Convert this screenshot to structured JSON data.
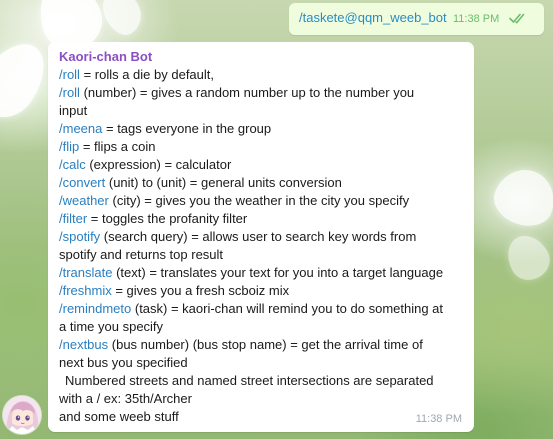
{
  "outgoing": {
    "text": "/taskete@qqm_weeb_bot",
    "time": "11:38 PM",
    "status_icon": "double-check-icon",
    "status_color": "#6cbc6c"
  },
  "incoming": {
    "sender": "Kaori-chan Bot",
    "sender_color": "#8b4ec4",
    "command_color": "#2a7fc0",
    "time": "11:38 PM",
    "lines": [
      {
        "cmd": "/roll",
        "text": " = rolls a die by default,"
      },
      {
        "cmd": "/roll",
        "text": " (number) = gives a random number up to the number you"
      },
      {
        "cmd": "",
        "text": "input"
      },
      {
        "cmd": "/meena",
        "text": " = tags everyone in the group"
      },
      {
        "cmd": "/flip",
        "text": " = flips a coin"
      },
      {
        "cmd": "/calc",
        "text": " (expression) = calculator"
      },
      {
        "cmd": "/convert",
        "text": " (unit) to (unit) = general units conversion"
      },
      {
        "cmd": "/weather",
        "text": " (city) = gives you the weather in the city you specify"
      },
      {
        "cmd": "/filter",
        "text": " = toggles the profanity filter"
      },
      {
        "cmd": "/spotify",
        "text": " (search query) = allows user to search key words from"
      },
      {
        "cmd": "",
        "text": "spotify and returns top result"
      },
      {
        "cmd": "/translate",
        "text": " (text) = translates your text for you into a target language"
      },
      {
        "cmd": "/freshmix",
        "text": " = gives you a fresh scboiz mix"
      },
      {
        "cmd": "/remindmeto",
        "text": " (task) = kaori-chan will remind you to do something at"
      },
      {
        "cmd": "",
        "text": "a time you specify"
      },
      {
        "cmd": "/nextbus",
        "text": " (bus number) (bus stop name) = get the arrival time of"
      },
      {
        "cmd": "",
        "text": "next bus you specified"
      },
      {
        "cmd": "",
        "text": "Numbered streets and named street intersections are separated",
        "indent": true
      },
      {
        "cmd": "",
        "text": "with a / ex: 35th/Archer"
      },
      {
        "cmd": "",
        "text": "and some weeb stuff"
      }
    ]
  },
  "avatar": {
    "icon": "anime-girl-avatar-icon"
  }
}
